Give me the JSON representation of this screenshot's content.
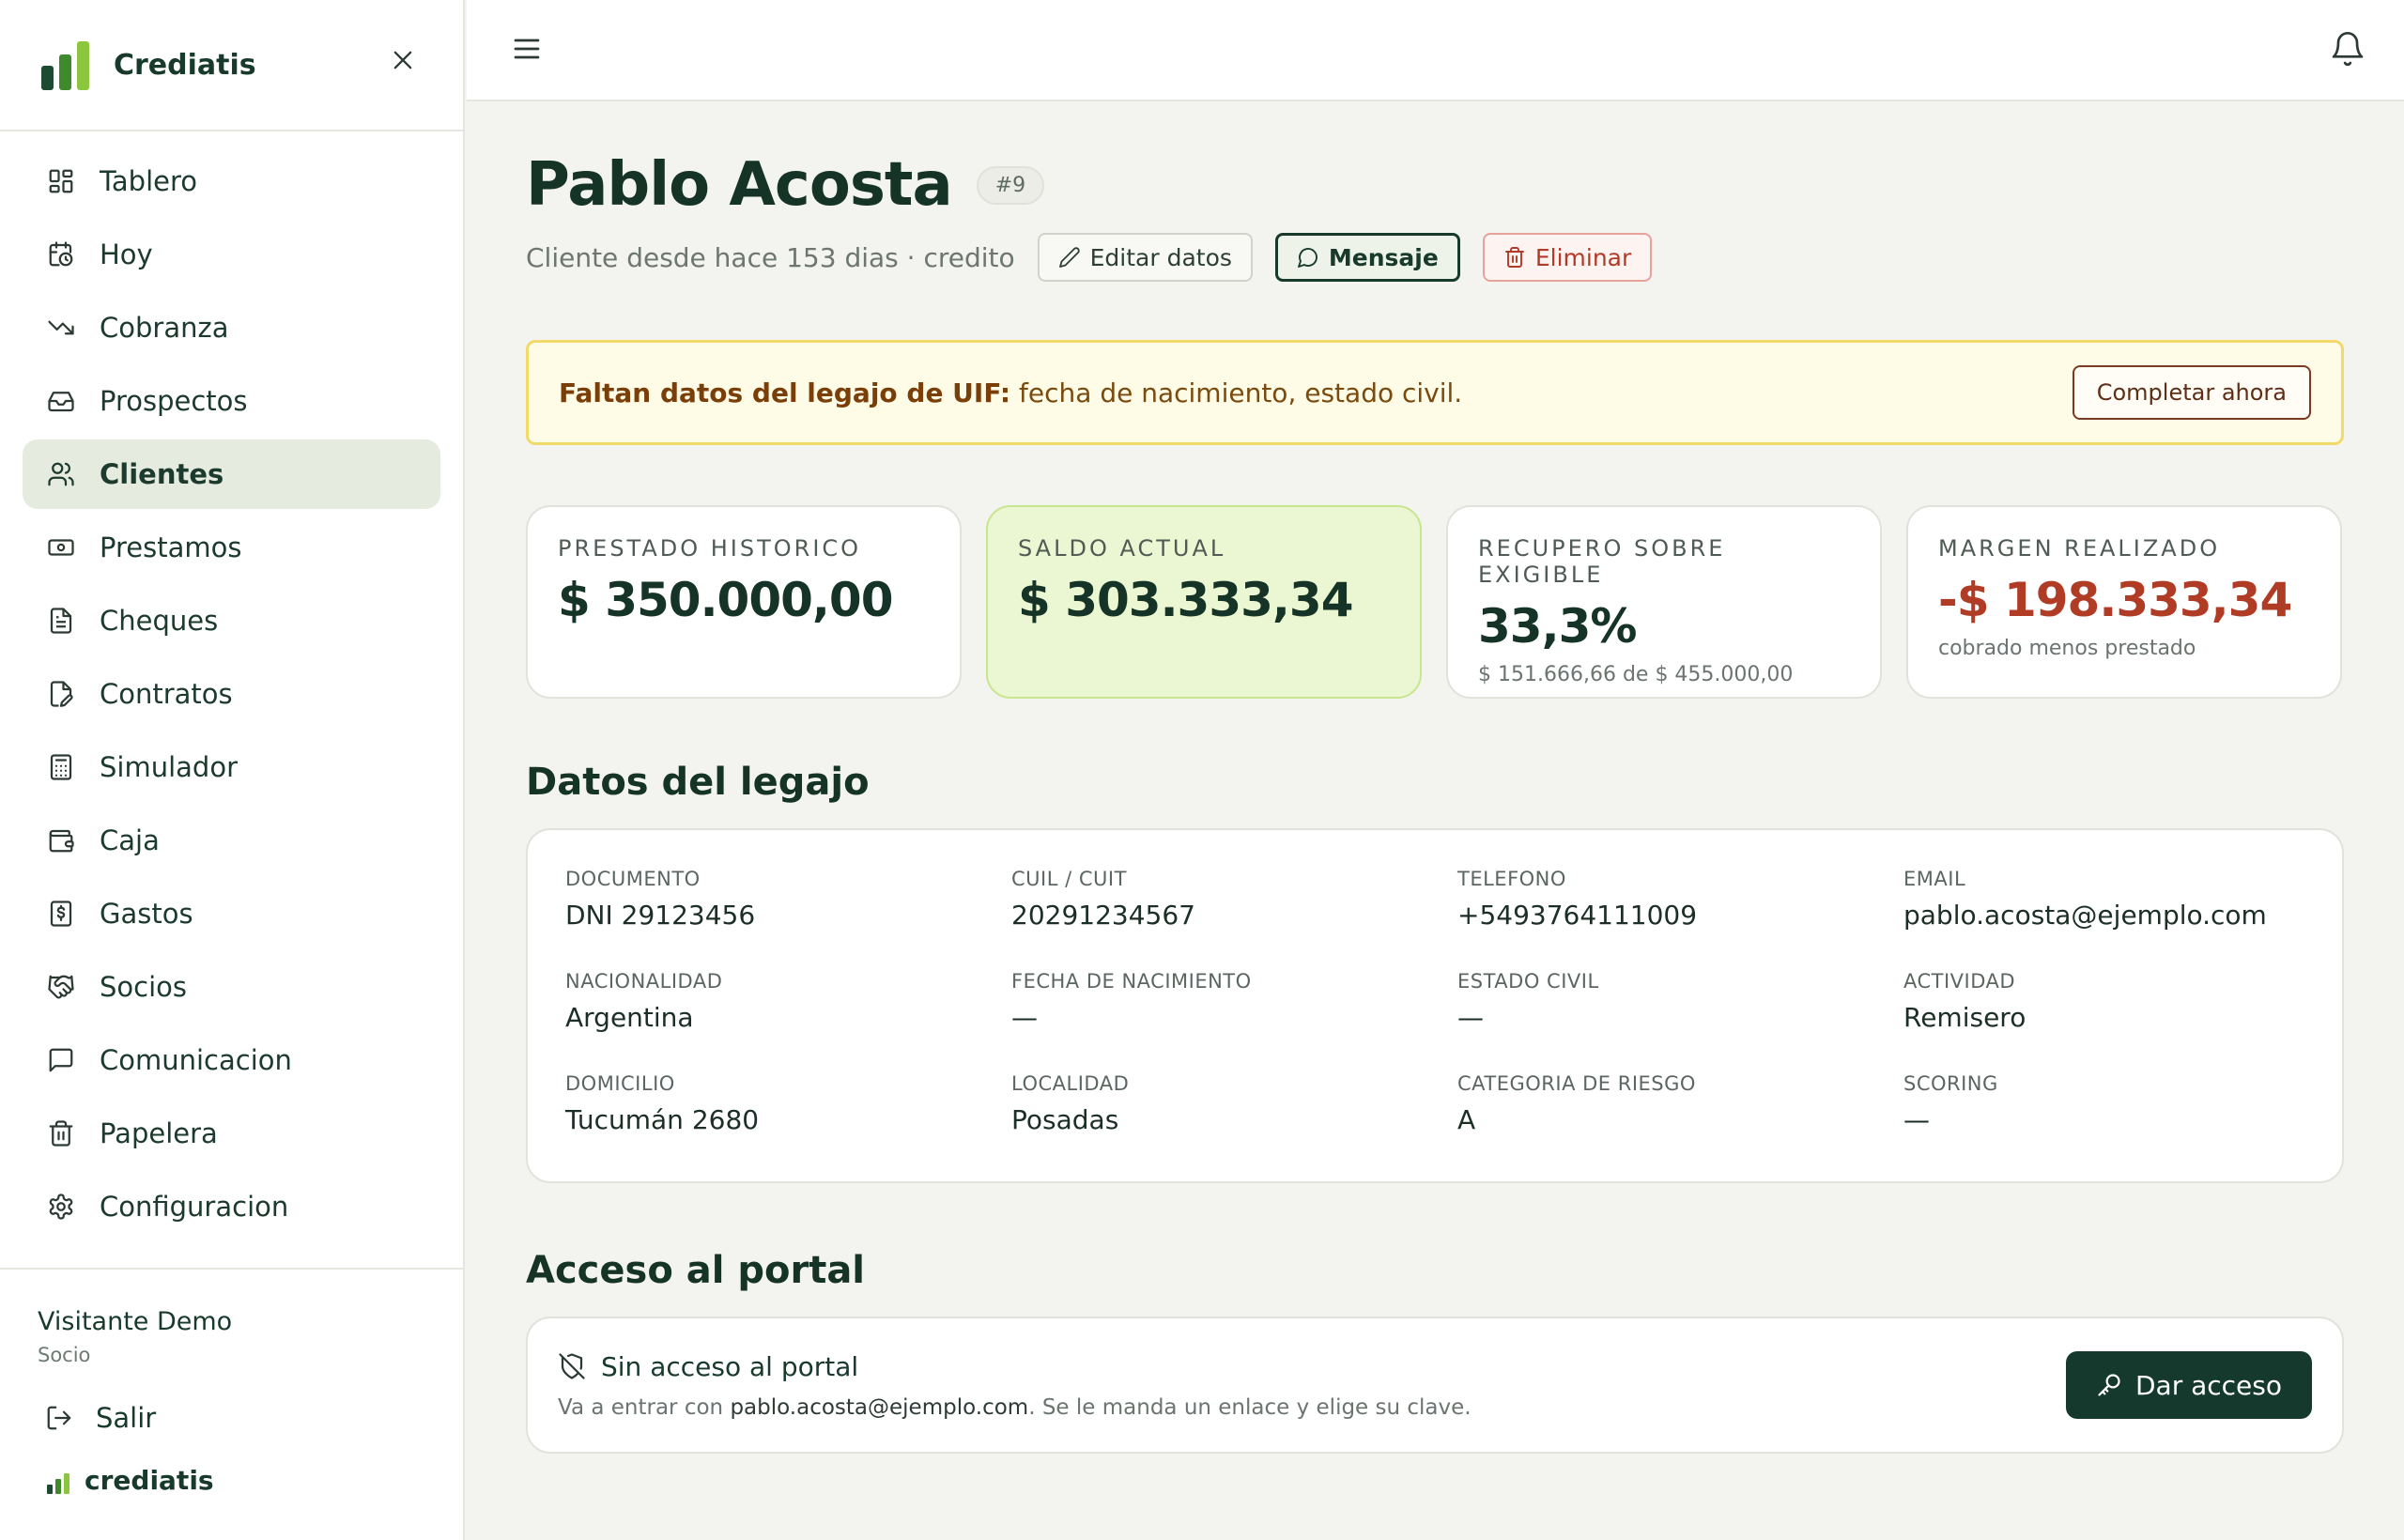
{
  "brand": {
    "name": "Crediatis",
    "footer_name": "crediatis",
    "colors": [
      "#1d4a33",
      "#3f8a2c",
      "#8cc63f"
    ]
  },
  "sidebar": {
    "items": [
      {
        "label": "Tablero",
        "icon": "dashboard-icon"
      },
      {
        "label": "Hoy",
        "icon": "calendar-clock-icon"
      },
      {
        "label": "Cobranza",
        "icon": "trending-down-icon"
      },
      {
        "label": "Prospectos",
        "icon": "inbox-icon"
      },
      {
        "label": "Clientes",
        "icon": "users-icon",
        "active": true
      },
      {
        "label": "Prestamos",
        "icon": "banknote-icon"
      },
      {
        "label": "Cheques",
        "icon": "file-text-icon"
      },
      {
        "label": "Contratos",
        "icon": "file-signature-icon"
      },
      {
        "label": "Simulador",
        "icon": "calculator-icon"
      },
      {
        "label": "Caja",
        "icon": "wallet-icon"
      },
      {
        "label": "Gastos",
        "icon": "receipt-dollar-icon"
      },
      {
        "label": "Socios",
        "icon": "handshake-icon"
      },
      {
        "label": "Comunicacion",
        "icon": "message-square-icon"
      },
      {
        "label": "Papelera",
        "icon": "trash-icon"
      },
      {
        "label": "Configuracion",
        "icon": "gear-icon"
      }
    ],
    "user": {
      "name": "Visitante Demo",
      "role": "Socio"
    },
    "logout_label": "Salir"
  },
  "client": {
    "name": "Pablo Acosta",
    "id_badge": "#9",
    "since": "Cliente desde hace 153 dias · credito",
    "actions": {
      "edit": "Editar datos",
      "message": "Mensaje",
      "delete": "Eliminar"
    }
  },
  "alert": {
    "bold": "Faltan datos del legajo de UIF:",
    "text": " fecha de nacimiento, estado civil.",
    "button": "Completar ahora"
  },
  "stats": [
    {
      "label": "PRESTADO HISTORICO",
      "value": "$ 350.000,00",
      "sub": ""
    },
    {
      "label": "SALDO ACTUAL",
      "value": "$ 303.333,34",
      "sub": ""
    },
    {
      "label": "RECUPERO SOBRE EXIGIBLE",
      "value": "33,3%",
      "sub": "$ 151.666,66 de $ 455.000,00"
    },
    {
      "label": "MARGEN REALIZADO",
      "value": "-$ 198.333,34",
      "sub": "cobrado menos prestado"
    }
  ],
  "legajo": {
    "title": "Datos del legajo",
    "fields": [
      {
        "label": "DOCUMENTO",
        "value": "DNI 29123456"
      },
      {
        "label": "CUIL / CUIT",
        "value": "20291234567"
      },
      {
        "label": "TELEFONO",
        "value": "+5493764111009"
      },
      {
        "label": "EMAIL",
        "value": "pablo.acosta@ejemplo.com"
      },
      {
        "label": "NACIONALIDAD",
        "value": "Argentina"
      },
      {
        "label": "FECHA DE NACIMIENTO",
        "value": "—"
      },
      {
        "label": "ESTADO CIVIL",
        "value": "—"
      },
      {
        "label": "ACTIVIDAD",
        "value": "Remisero"
      },
      {
        "label": "DOMICILIO",
        "value": "Tucumán 2680"
      },
      {
        "label": "LOCALIDAD",
        "value": "Posadas"
      },
      {
        "label": "CATEGORIA DE RIESGO",
        "value": "A"
      },
      {
        "label": "SCORING",
        "value": "—"
      }
    ]
  },
  "portal": {
    "title": "Acceso al portal",
    "status": "Sin acceso al portal",
    "desc_prefix": "Va a entrar con ",
    "desc_email": "pablo.acosta@ejemplo.com",
    "desc_suffix": ". Se le manda un enlace y elige su clave.",
    "button": "Dar acceso"
  }
}
